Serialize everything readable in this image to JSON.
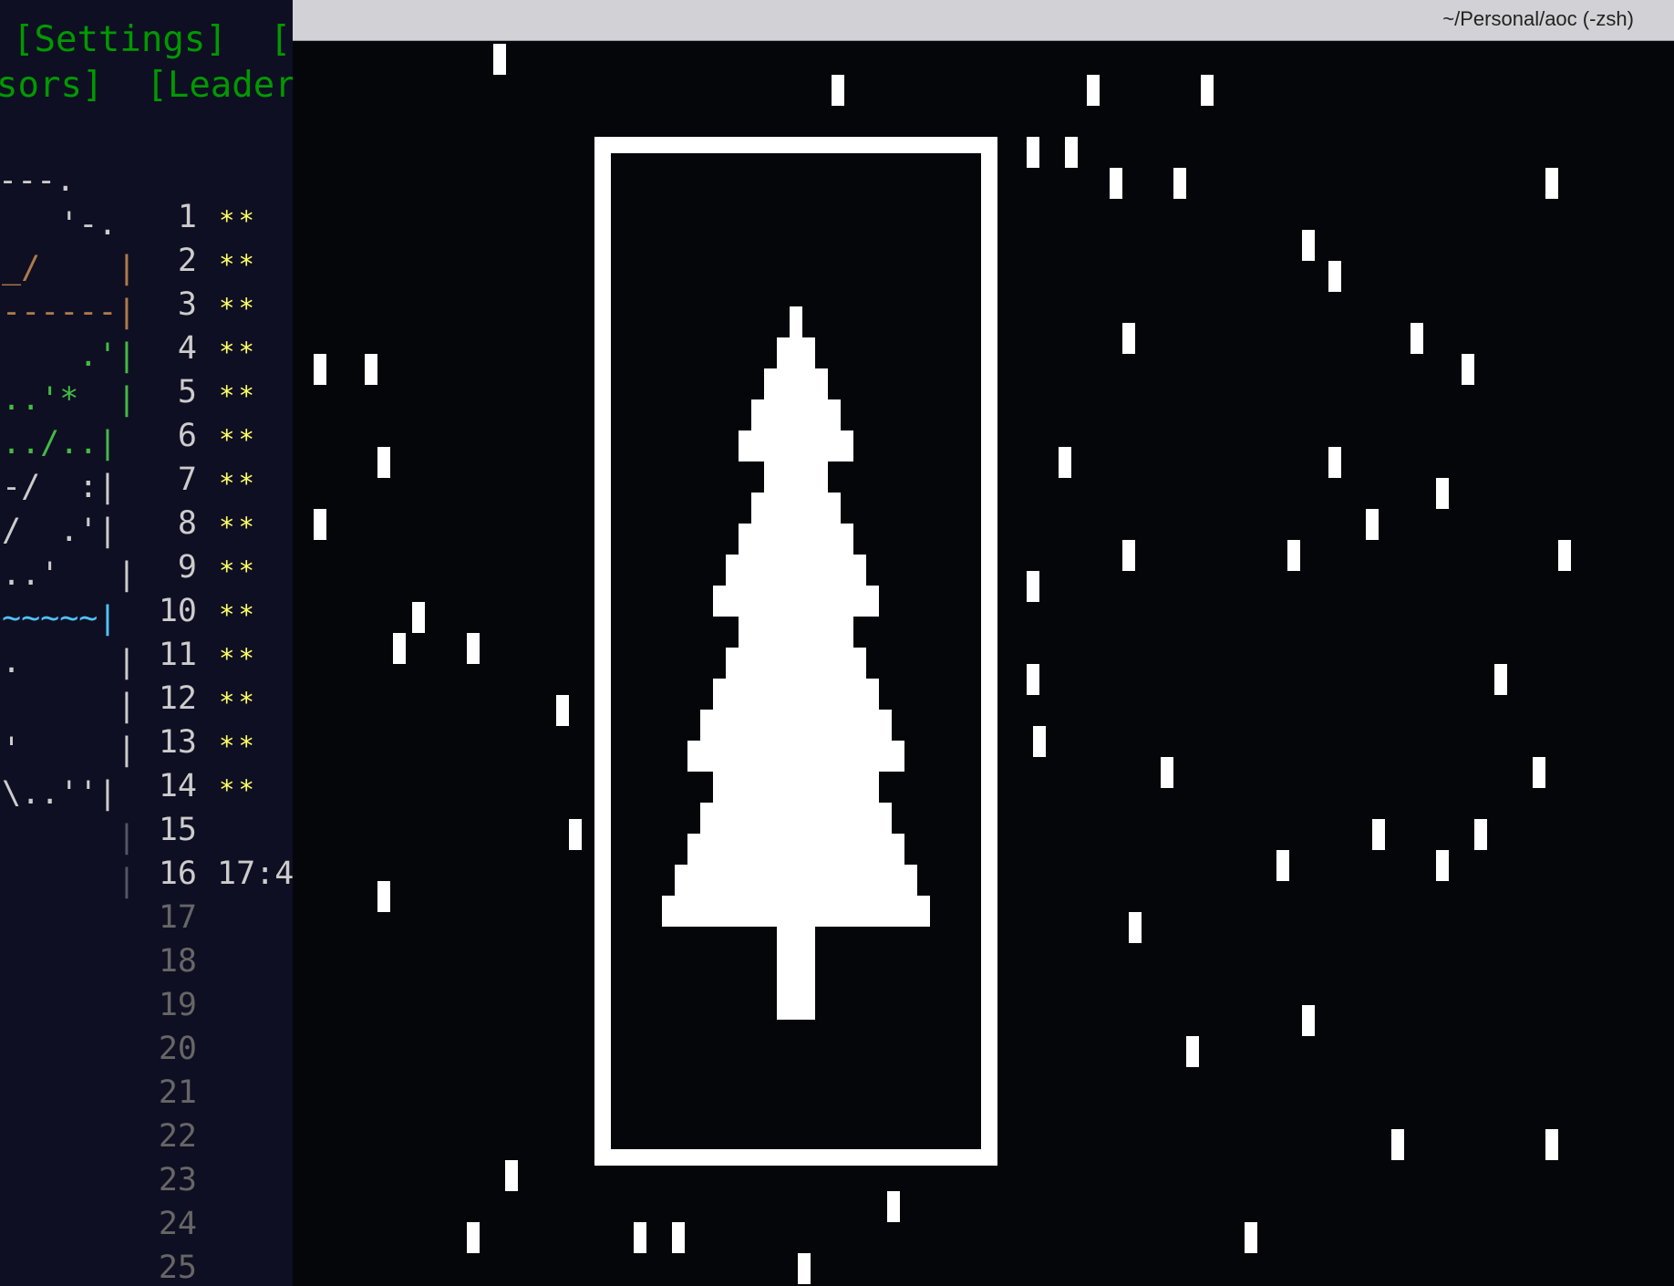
{
  "browser": {
    "nav": {
      "row1": "[Settings]  [L",
      "row2": "sors]  [Leaderb"
    },
    "calendar": {
      "art_lines": [
        "---.",
        "   '-.",
        "_/    |",
        "------|",
        "    .'|",
        "..'*  |",
        "../..|",
        "-/  :|",
        "/  .'|",
        "..'   |",
        "~~~~~|",
        ".     |",
        "      |",
        "'     |",
        "\\..''|",
        "      |",
        "      |"
      ],
      "days": [
        {
          "num": "1",
          "stars": "**"
        },
        {
          "num": "2",
          "stars": "**"
        },
        {
          "num": "3",
          "stars": "**"
        },
        {
          "num": "4",
          "stars": "**"
        },
        {
          "num": "5",
          "stars": "**"
        },
        {
          "num": "6",
          "stars": "**"
        },
        {
          "num": "7",
          "stars": "**"
        },
        {
          "num": "8",
          "stars": "**"
        },
        {
          "num": "9",
          "stars": "**"
        },
        {
          "num": "10",
          "stars": "**"
        },
        {
          "num": "11",
          "stars": "**"
        },
        {
          "num": "12",
          "stars": "**"
        },
        {
          "num": "13",
          "stars": "**"
        },
        {
          "num": "14",
          "stars": "**"
        },
        {
          "num": "15",
          "stars": ""
        },
        {
          "num": "16",
          "stars": "",
          "time": "17:4"
        },
        {
          "num": "17",
          "stars": ""
        },
        {
          "num": "18",
          "stars": ""
        },
        {
          "num": "19",
          "stars": ""
        },
        {
          "num": "20",
          "stars": ""
        },
        {
          "num": "21",
          "stars": ""
        },
        {
          "num": "22",
          "stars": ""
        },
        {
          "num": "23",
          "stars": ""
        },
        {
          "num": "24",
          "stars": ""
        },
        {
          "num": "25",
          "stars": ""
        }
      ]
    }
  },
  "terminal": {
    "title": "~/Personal/aoc (-zsh)"
  },
  "colors": {
    "terminal_bg": "#05060a",
    "aoc_bg": "#0f0f23",
    "nav_green": "#009900",
    "star_yellow": "#ffff66",
    "titlebar": "#d2d2d6"
  }
}
